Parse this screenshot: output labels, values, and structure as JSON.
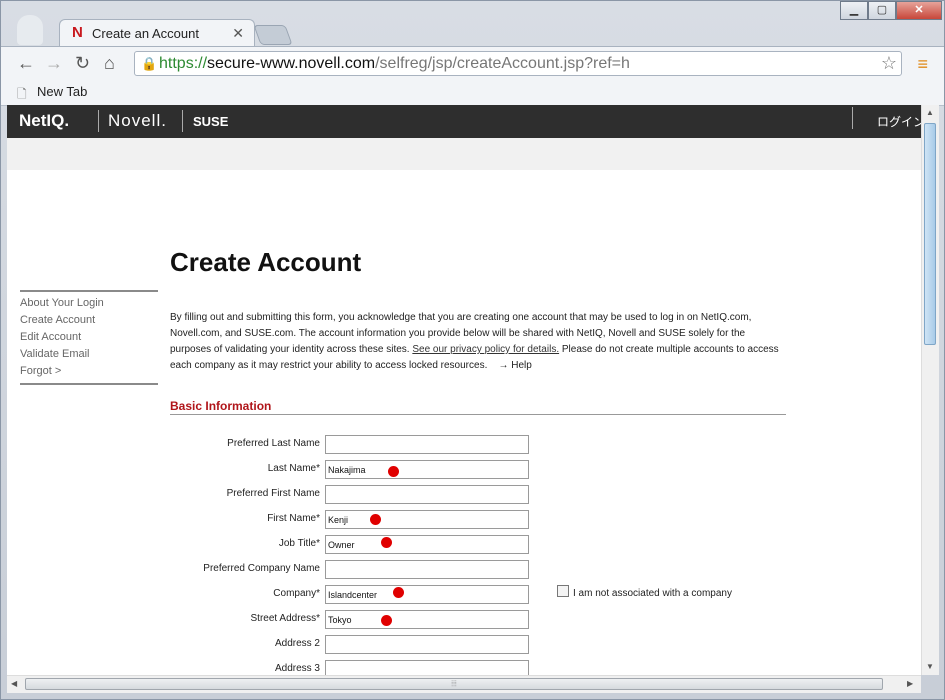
{
  "browser": {
    "tab_title": "Create an Account",
    "tab_favicon": "N",
    "url_scheme": "https://",
    "url_host": "secure-www.novell.com",
    "url_path": "/selfreg/jsp/createAccount.jsp?ref=h",
    "bookmark": "New Tab"
  },
  "header": {
    "brand_netiq": "NetIQ.",
    "brand_novell": "Novell.",
    "brand_suse": "SUSE",
    "login": "ログイン"
  },
  "sidebar": {
    "items": [
      {
        "label": "About Your Login"
      },
      {
        "label": "Create Account"
      },
      {
        "label": "Edit Account"
      },
      {
        "label": "Validate Email"
      },
      {
        "label": "Forgot  >"
      }
    ]
  },
  "main": {
    "title": "Create Account",
    "intro_1": "By filling out and submitting this form, you acknowledge that you are creating one account that may be used to log in on NetIQ.com, Novell.com, and SUSE.com.  The account information you provide below will be shared with NetIQ, Novell and SUSE solely for the purposes of validating your identity across these sites.",
    "privacy_link": "See our privacy policy for details.",
    "intro_2": "Please do not create multiple accounts to access each company as it may restrict your ability to access locked resources.",
    "help_link": "→ Help",
    "section": "Basic Information",
    "fields": [
      {
        "label": "Preferred Last Name",
        "value": ""
      },
      {
        "label": "Last Name*",
        "value": "Nakajima"
      },
      {
        "label": "Preferred First Name",
        "value": ""
      },
      {
        "label": "First Name*",
        "value": "Kenji"
      },
      {
        "label": "Job Title*",
        "value": "Owner"
      },
      {
        "label": "Preferred Company Name",
        "value": ""
      },
      {
        "label": "Company*",
        "value": "Islandcenter"
      },
      {
        "label": "Street Address*",
        "value": "Tokyo"
      },
      {
        "label": "Address 2",
        "value": ""
      },
      {
        "label": "Address 3",
        "value": ""
      }
    ],
    "no_company_label": "I am not associated with a company"
  },
  "colors": {
    "accent_red": "#b0151a",
    "marker_red": "#e00000",
    "header_bg": "#2e2e2e"
  }
}
